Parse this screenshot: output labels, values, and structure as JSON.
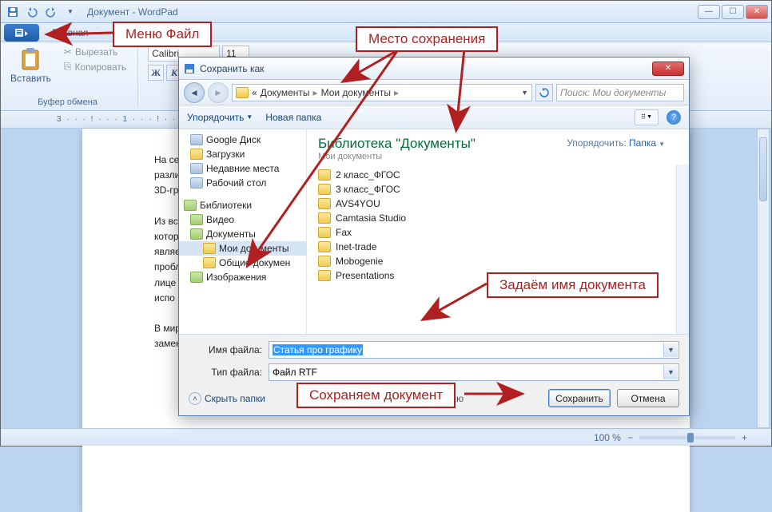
{
  "window": {
    "title": "Документ - WordPad",
    "tab_main": "Главная",
    "group_clipboard": "Буфер обмена",
    "paste": "Вставить",
    "cut": "Вырезать",
    "copy": "Копировать",
    "font_name": "Calibri",
    "font_size": "11",
    "ruler": "3 · · · ! · · · 1 · · · ! · ·",
    "zoom": "100 %"
  },
  "doc": {
    "p1": "На се",
    "p2": "разли",
    "p3": "3D-гр",
    "p4": "Из вс",
    "p5": "котор",
    "p6": "являе",
    "p7": "пробл",
    "p8": "лице",
    "p9": "испо",
    "p10": "В мир",
    "p11": "замен"
  },
  "dialog": {
    "title": "Сохранить как",
    "crumb_prefix": "«",
    "crumb1": "Документы",
    "crumb2": "Мои документы",
    "search_placeholder": "Поиск: Мои документы",
    "organize": "Упорядочить",
    "new_folder": "Новая папка",
    "lib_title": "Библиотека \"Документы\"",
    "lib_sub": "Мои документы",
    "sort_label": "Упорядочить:",
    "sort_value": "Папка",
    "filename_label": "Имя файла:",
    "filename_value": "Статья про графику",
    "filetype_label": "Тип файла:",
    "filetype_value": "Файл RTF",
    "default_chk": "По умолчанию",
    "hide_folders": "Скрыть папки",
    "save_btn": "Сохранить",
    "cancel_btn": "Отмена"
  },
  "tree": [
    {
      "label": "Google Диск",
      "icon": "gen",
      "lvl": 1
    },
    {
      "label": "Загрузки",
      "icon": "fold",
      "lvl": 1
    },
    {
      "label": "Недавние места",
      "icon": "gen",
      "lvl": 1
    },
    {
      "label": "Рабочий стол",
      "icon": "gen",
      "lvl": 1
    },
    {
      "label": "",
      "spacer": true
    },
    {
      "label": "Библиотеки",
      "icon": "lib",
      "lvl": 0
    },
    {
      "label": "Видео",
      "icon": "lib",
      "lvl": 1
    },
    {
      "label": "Документы",
      "icon": "lib",
      "lvl": 1
    },
    {
      "label": "Мои документы",
      "icon": "fold",
      "lvl": 2,
      "sel": true
    },
    {
      "label": "Общие докумен",
      "icon": "fold",
      "lvl": 2
    },
    {
      "label": "Изображения",
      "icon": "lib",
      "lvl": 1
    }
  ],
  "files": [
    "2 класс_ФГОС",
    "3 класс_ФГОС",
    "AVS4YOU",
    "Camtasia Studio",
    "Fax",
    "Inet-trade",
    "Mobogenie",
    "Presentations"
  ],
  "callouts": {
    "c1": "Меню Файл",
    "c2": "Место сохранения",
    "c3": "Задаём имя документа",
    "c4": "Сохраняем документ"
  }
}
